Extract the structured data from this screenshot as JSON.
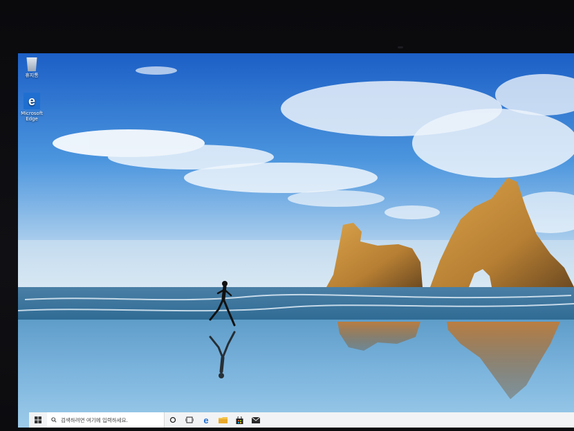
{
  "desktop": {
    "icons": [
      {
        "label": "휴지통",
        "icon": "recycle-bin-icon"
      },
      {
        "label": "Microsoft Edge",
        "icon": "edge-icon"
      }
    ]
  },
  "taskbar": {
    "search_placeholder": "검색하려면 여기에 입력하세요.",
    "pinned": [
      "cortana-icon",
      "task-view-icon",
      "edge-icon",
      "file-explorer-icon",
      "store-icon",
      "mail-icon"
    ]
  },
  "colors": {
    "sky_top": "#1f63c9",
    "sky_bottom": "#cfe3f4",
    "sea": "#3d78a0",
    "sand": "#7fb3d6",
    "rock": "#c9913e",
    "taskbar": "#f2f3f5"
  }
}
